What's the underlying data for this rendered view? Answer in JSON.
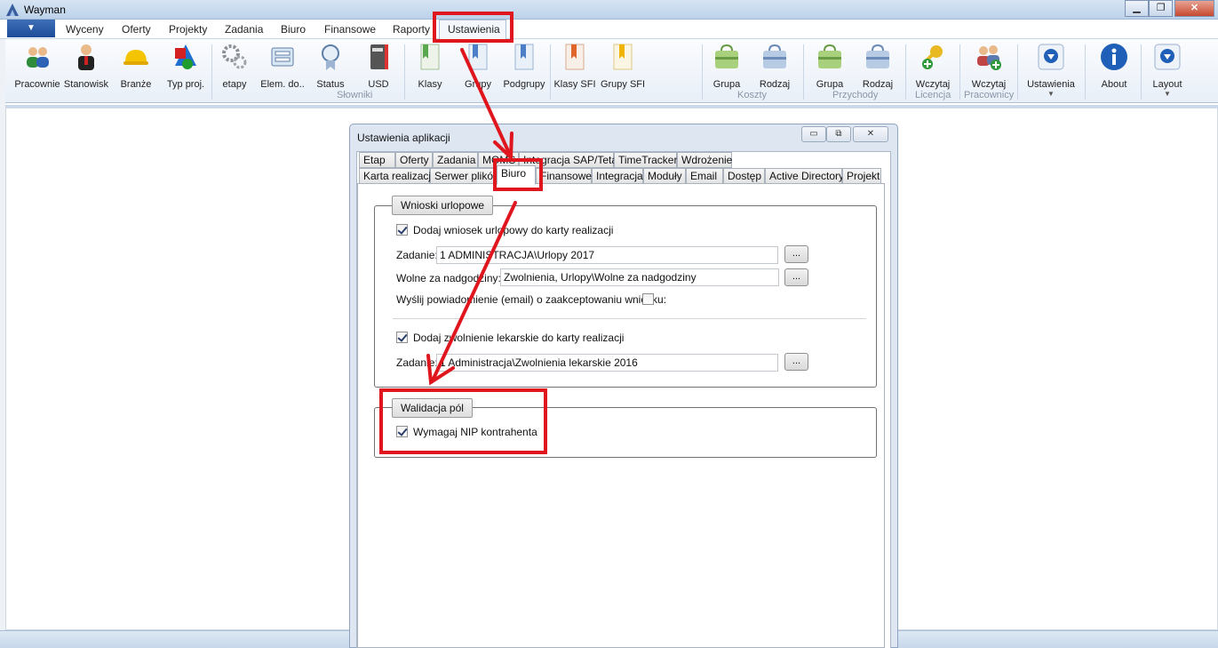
{
  "window": {
    "title": "Wayman"
  },
  "menu": {
    "items": [
      "Wyceny",
      "Oferty",
      "Projekty",
      "Zadania",
      "Biuro",
      "Finansowe",
      "Raporty",
      "Ustawienia"
    ]
  },
  "ribbon": {
    "buttons": [
      {
        "label": "Pracownie",
        "icon": "users-icon"
      },
      {
        "label": "Stanowisk",
        "icon": "person-icon"
      },
      {
        "label": "Branże",
        "icon": "hardhat-icon"
      },
      {
        "label": "Typ proj.",
        "icon": "shapes-icon"
      },
      {
        "label": "etapy",
        "icon": "gears-icon"
      },
      {
        "label": "Elem. do..",
        "icon": "tray-icon"
      },
      {
        "label": "Status",
        "icon": "certificate-icon"
      },
      {
        "label": "USD",
        "icon": "binder-icon"
      },
      {
        "label": "Klasy",
        "icon": "bookmark-green-icon"
      },
      {
        "label": "Grupy",
        "icon": "bookmark-blue-icon"
      },
      {
        "label": "Podgrupy",
        "icon": "bookmark-blue-icon"
      },
      {
        "label": "Klasy SFI",
        "icon": "bookmark-orange-icon"
      },
      {
        "label": "Grupy SFI",
        "icon": "bookmark-yellow-icon"
      },
      {
        "label": "Grupa",
        "icon": "bag-green-icon"
      },
      {
        "label": "Rodzaj",
        "icon": "bag-blue-icon"
      },
      {
        "label": "Grupa",
        "icon": "bag-green-icon"
      },
      {
        "label": "Rodzaj",
        "icon": "bag-blue-icon"
      },
      {
        "label": "Wczytaj",
        "icon": "key-add-icon"
      },
      {
        "label": "Wczytaj",
        "icon": "users-add-icon"
      },
      {
        "label": "Ustawienia",
        "icon": "down-circle-icon"
      },
      {
        "label": "About",
        "icon": "info-icon"
      },
      {
        "label": "Layout",
        "icon": "down-circle-icon"
      }
    ],
    "groups": [
      "Słowniki",
      "Koszty",
      "Przychody",
      "Licencja",
      "Pracownicy"
    ]
  },
  "dialog": {
    "title": "Ustawienia aplikacji",
    "tabs_row1": [
      "Etap",
      "Oferty",
      "Zadania",
      "MOMS",
      "Integracja SAP/Teta",
      "TimeTracker",
      "Wdrożenie"
    ],
    "tabs_row2": [
      "Karta realizacji",
      "Serwer plików",
      "Biuro",
      "Finansowe",
      "Integracja",
      "Moduły",
      "Email",
      "Dostęp",
      "Active Directory",
      "Projekt"
    ],
    "leave": {
      "header": "Wnioski urlopowe",
      "add_leave_label": "Dodaj wniosek urlopowy do karty realizacji",
      "add_leave_checked": true,
      "task_label": "Zadanie:",
      "task_value": "1 ADMINISTRACJA\\Urlopy 2017",
      "overtime_label": "Wolne za nadgodziny:",
      "overtime_value": "Zwolnienia, Urlopy\\Wolne za nadgodziny",
      "notify_label": "Wyślij powiadomienie (email) o zaakceptowaniu wniosku:",
      "notify_checked": false,
      "add_sick_label": "Dodaj zwolnienie lekarskie do karty realizacji",
      "add_sick_checked": true,
      "sick_task_label": "Zadanie:",
      "sick_task_value": "1 Administracja\\Zwolnienia lekarskie 2016",
      "browse_label": "..."
    },
    "validation": {
      "header": "Walidacja pól",
      "nip_label": "Wymagaj NIP kontrahenta",
      "nip_checked": true
    }
  },
  "colors": {
    "annotation": "#e0161e",
    "accent": "#1c4c98"
  }
}
